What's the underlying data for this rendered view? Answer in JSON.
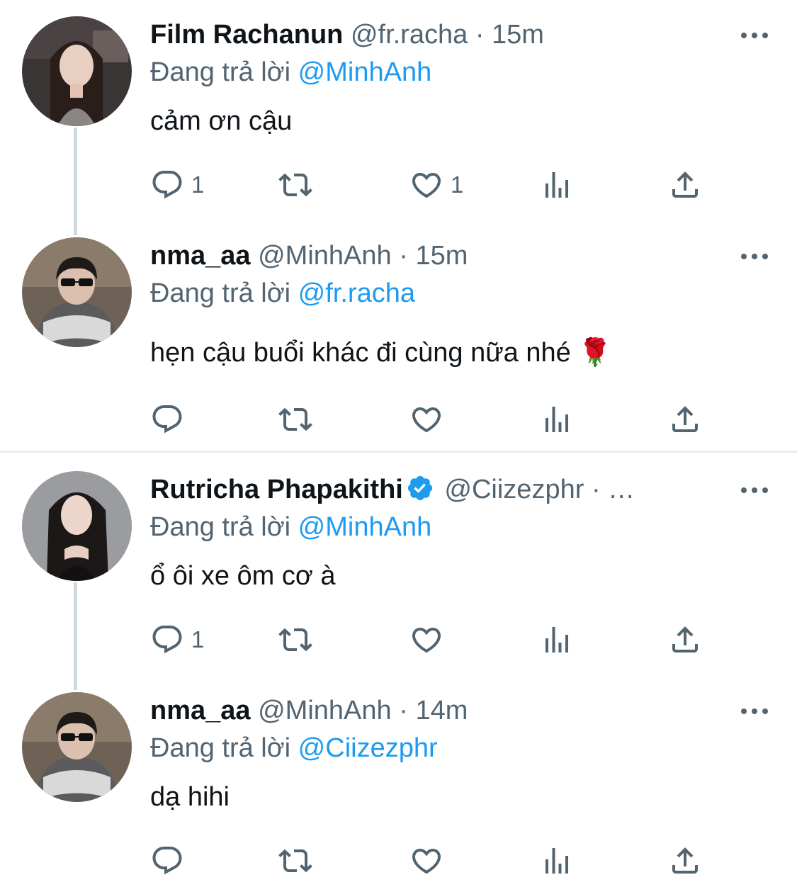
{
  "tweets": [
    {
      "name": "Film Rachanun",
      "handle": "@fr.racha",
      "dot": "·",
      "time": "15m",
      "reply_prefix": "Đang trả lời",
      "reply_mention": "@MinhAnh",
      "text": "cảm ơn cậu",
      "reply_count": "1",
      "like_count": "1"
    },
    {
      "name": "nma_aa",
      "handle": "@MinhAnh",
      "dot": "·",
      "time": "15m",
      "reply_prefix": "Đang trả lời",
      "reply_mention": "@fr.racha",
      "text": "hẹn cậu buổi khác đi cùng nữa nhé 🌹",
      "reply_count": "",
      "like_count": ""
    },
    {
      "name": "Rutricha Phapakithi",
      "handle": "@Ciizezphr",
      "dot": "· …",
      "time": "",
      "verified": true,
      "reply_prefix": "Đang trả lời",
      "reply_mention": "@MinhAnh",
      "text": "ổ ôi xe ôm cơ à",
      "reply_count": "1",
      "like_count": ""
    },
    {
      "name": "nma_aa",
      "handle": "@MinhAnh",
      "dot": "·",
      "time": "14m",
      "reply_prefix": "Đang trả lời",
      "reply_mention": "@Ciizezphr",
      "text": "dạ hihi",
      "reply_count": "",
      "like_count": ""
    }
  ],
  "icons": {
    "reply": "reply-icon",
    "retweet": "retweet-icon",
    "like": "heart-icon",
    "views": "views-icon",
    "share": "share-icon",
    "more": "more-icon",
    "verified": "verified-badge-icon"
  },
  "colors": {
    "link": "#1d9bf0",
    "secondary_text": "#536471",
    "primary_text": "#0f1419",
    "thread_line": "#cfd9de",
    "separator": "#e6ecf0"
  }
}
